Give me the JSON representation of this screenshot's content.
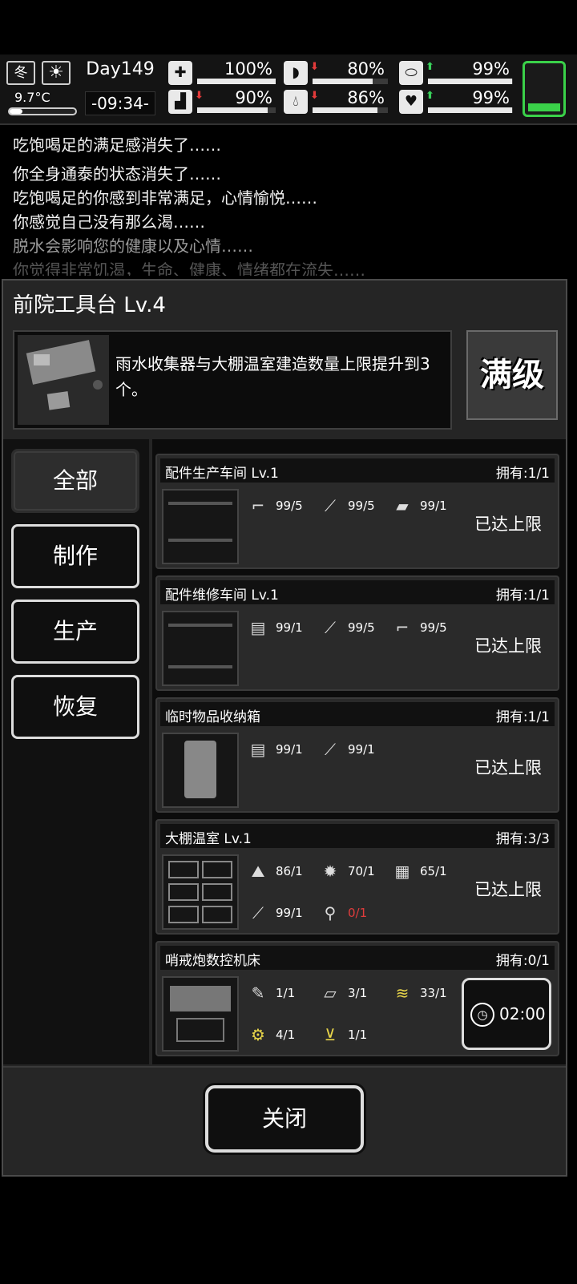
{
  "hud": {
    "season": "冬",
    "weather_icon": "sun-icon",
    "temperature": "9.7°C",
    "day": "Day149",
    "time": "-09:34-",
    "stats": [
      {
        "icon": "medkit-icon",
        "value": "100%",
        "level": 1.0,
        "trend": ""
      },
      {
        "icon": "stomach-icon",
        "value": "80%",
        "level": 0.8,
        "trend": "down"
      },
      {
        "icon": "pill-icon",
        "value": "99%",
        "level": 0.99,
        "trend": "up"
      },
      {
        "icon": "foot-icon",
        "value": "90%",
        "level": 0.9,
        "trend": "down"
      },
      {
        "icon": "water-drop-icon",
        "value": "86%",
        "level": 0.86,
        "trend": "down"
      },
      {
        "icon": "heart-icon",
        "value": "99%",
        "level": 0.99,
        "trend": "up"
      }
    ],
    "colors": {
      "up": "#39d15b",
      "down": "#e23a3a",
      "accent": "#3ad149"
    }
  },
  "log": [
    "吃饱喝足的满足感消失了……",
    "你全身通泰的状态消失了……",
    "吃饱喝足的你感到非常满足，心情愉悦……",
    "你感觉自己没有那么渴……",
    "脱水会影响您的健康以及心情……",
    "你觉得非常饥渴，生命、健康、情绪都在流失……"
  ],
  "panel": {
    "title": "前院工具台 Lv.4",
    "description": "雨水收集器与大棚温室建造数量上限提升到3个。",
    "max_badge": "满级",
    "tabs": [
      "全部",
      "制作",
      "生产",
      "恢复"
    ],
    "items": [
      {
        "name": "配件生产车间 Lv.1",
        "owned": "拥有:1/1",
        "reqs": [
          {
            "icon": "pipe-icon",
            "value": "99/5"
          },
          {
            "icon": "nails-icon",
            "value": "99/5"
          },
          {
            "icon": "plank-icon",
            "value": "99/1"
          }
        ],
        "status": "已达上限"
      },
      {
        "name": "配件维修车间 Lv.1",
        "owned": "拥有:1/1",
        "reqs": [
          {
            "icon": "cloth-roll-icon",
            "value": "99/1"
          },
          {
            "icon": "nails-icon",
            "value": "99/5"
          },
          {
            "icon": "pipe-icon",
            "value": "99/5"
          }
        ],
        "status": "已达上限"
      },
      {
        "name": "临时物品收纳箱",
        "owned": "拥有:1/1",
        "reqs": [
          {
            "icon": "cloth-roll-icon",
            "value": "99/1"
          },
          {
            "icon": "nails-icon",
            "value": "99/1"
          }
        ],
        "status": "已达上限"
      },
      {
        "name": "大棚温室 Lv.1",
        "owned": "拥有:3/3",
        "reqs": [
          {
            "icon": "soil-icon",
            "value": "86/1"
          },
          {
            "icon": "straw-icon",
            "value": "70/1"
          },
          {
            "icon": "bricks-icon",
            "value": "65/1"
          },
          {
            "icon": "nails-icon",
            "value": "99/1"
          },
          {
            "icon": "shovel-icon",
            "value": "0/1"
          }
        ],
        "status": "已达上限"
      },
      {
        "name": "哨戒炮数控机床",
        "owned": "拥有:0/1",
        "reqs": [
          {
            "icon": "chisel-icon",
            "value": "1/1"
          },
          {
            "icon": "metal-sheet-icon",
            "value": "3/1"
          },
          {
            "icon": "spring-icon",
            "value": "33/1"
          },
          {
            "icon": "gear-parts-icon",
            "value": "4/1"
          },
          {
            "icon": "vest-icon",
            "value": "1/1"
          }
        ],
        "timer": "02:00"
      }
    ],
    "close_label": "关闭"
  }
}
